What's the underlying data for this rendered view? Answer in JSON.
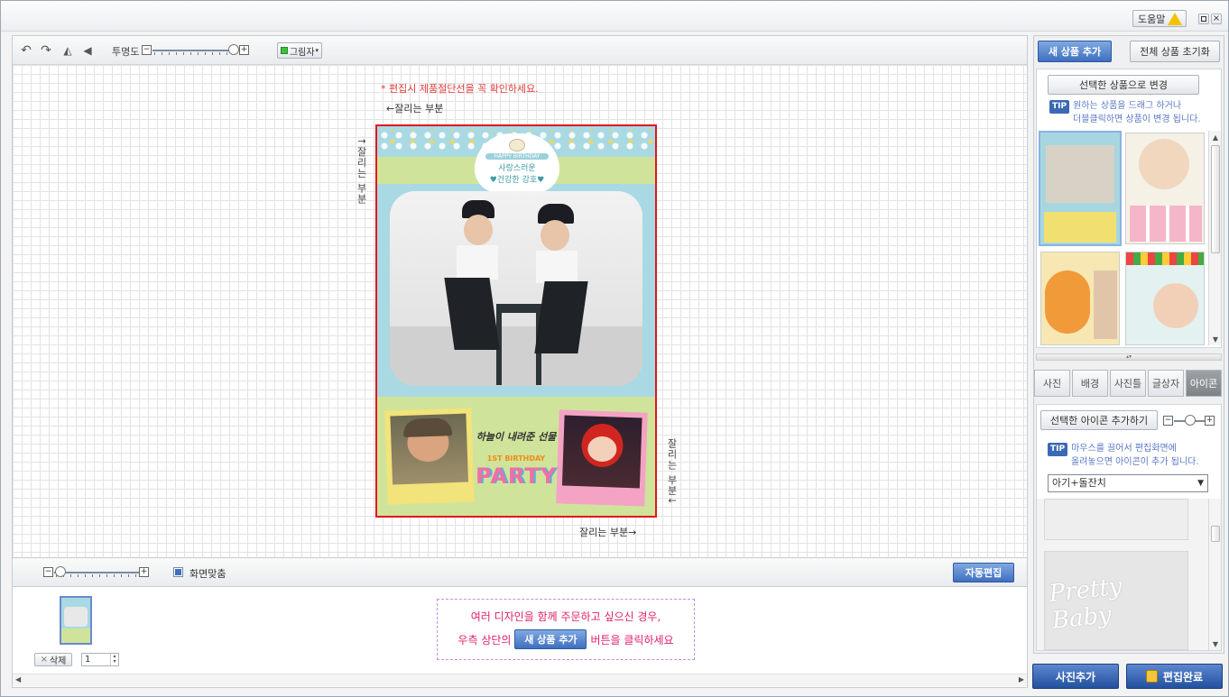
{
  "titlebar": {
    "help_label": "도움말"
  },
  "editor_toolbar": {
    "opacity_label": "투명도",
    "shadow_label": "그림자"
  },
  "canvas": {
    "warning": "* 편집시 제품절단선을 꼭 확인하세요.",
    "cut_top": "←잘리는 부분",
    "cut_left": "↑잘리는 부분",
    "cut_right": "잘리는 부분↓",
    "cut_bottom": "잘리는 부분→"
  },
  "design": {
    "banner_small": "HAPPY BIRTHDAY",
    "banner_line1": "사랑스러운",
    "banner_line2": "♥건강한 강호♥",
    "gift_text": "하늘이 내려준 선물",
    "birthday_text": "1ST BIRTHDAY",
    "party_text": "PARTY"
  },
  "bottom_toolbar": {
    "fit_label": "화면맞춤",
    "auto_edit_label": "자동편집"
  },
  "pages": {
    "delete_label": "삭제",
    "quantity": "1"
  },
  "notice": {
    "line1": "여러 디자인을 함께 주문하고 싶으신 경우,",
    "line2_prefix": "우측 상단의",
    "button_label": "새 상품 추가",
    "line2_suffix": "버튼을 클릭하세요"
  },
  "right_panel": {
    "new_product_label": "새 상품 추가",
    "reset_all_label": "전체 상품 초기화",
    "change_selected_label": "선택한 상품으로 변경",
    "tip_badge": "TIP",
    "tip1_line1": "원하는 상품을 드래그 하거나",
    "tip1_line2": "더블클릭하면 상품이 변경 됩니다.",
    "tabs": [
      "사진",
      "배경",
      "사진틀",
      "글상자",
      "아이콘"
    ],
    "add_icon_label": "선택한 아이콘 추가하기",
    "tip2_line1": "마우스를 끌어서 편집화면에",
    "tip2_line2": "올려놓으면 아이콘이 추가 됩니다.",
    "category_selected": "아기+돌잔치",
    "icon_preview_text": "Pretty Baby"
  },
  "footer": {
    "add_photo_label": "사진추가",
    "edit_complete_label": "편집완료"
  },
  "colors": {
    "accent_blue": "#3f6fc0",
    "selection_red": "#e0141e",
    "warning_red": "#e23b3b",
    "notice_pink": "#e0216a",
    "tip_blue": "#5b78c4"
  }
}
